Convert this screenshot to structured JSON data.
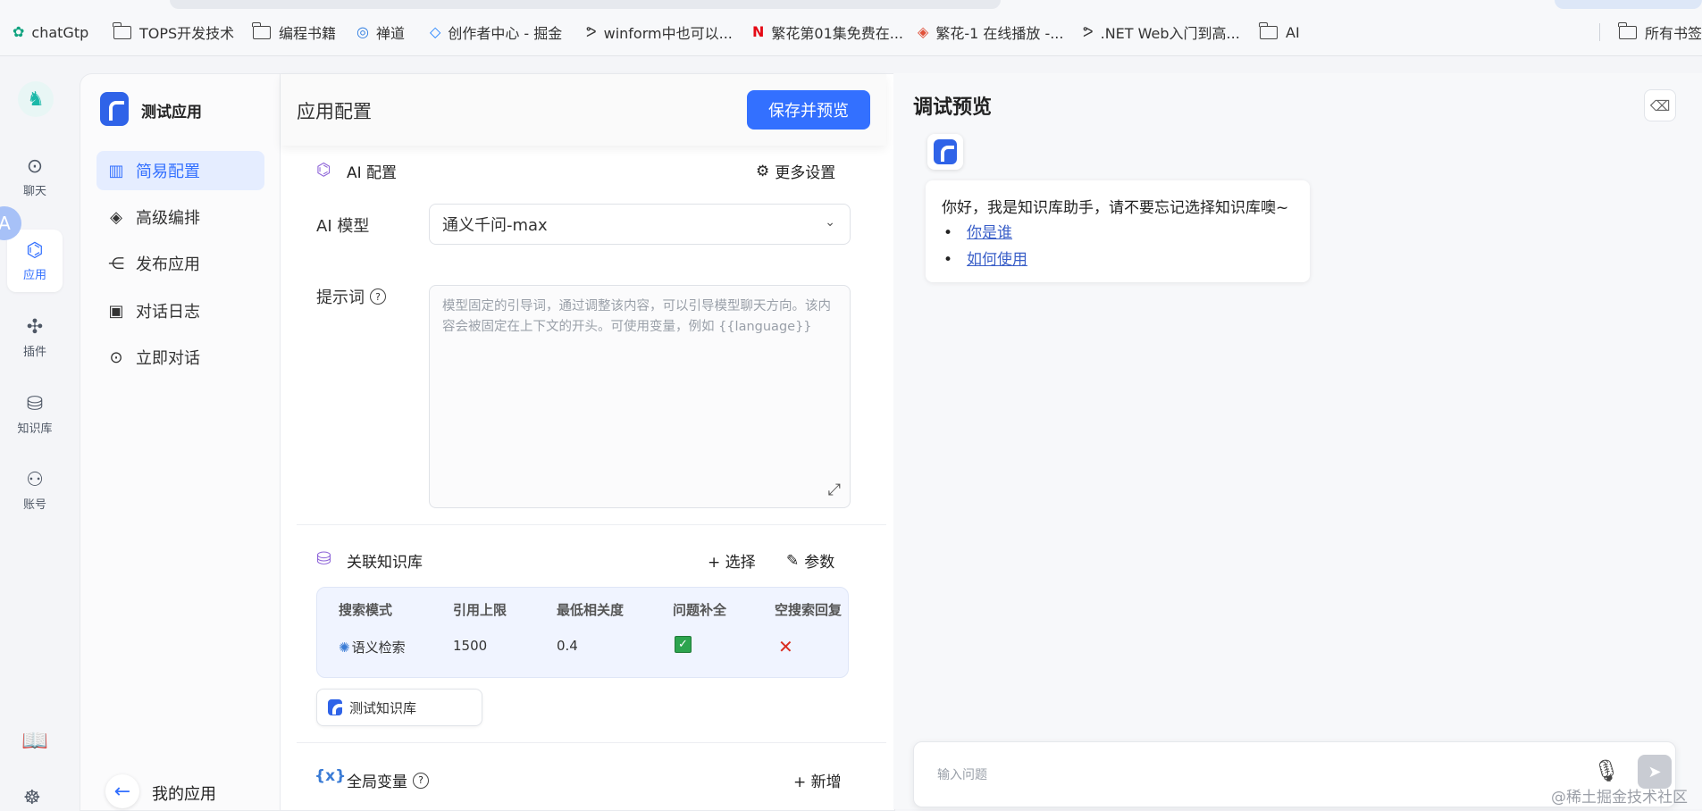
{
  "bookmarks": [
    {
      "label": "chatGtp",
      "icon": "chatgpt-icon"
    },
    {
      "label": "TOPS开发技术",
      "icon": "folder-icon"
    },
    {
      "label": "编程书籍",
      "icon": "folder-icon"
    },
    {
      "label": "禅道",
      "icon": "zentao-icon"
    },
    {
      "label": "创作者中心 - 掘金",
      "icon": "juejin-icon"
    },
    {
      "label": "winform中也可以...",
      "icon": "csdn-icon"
    },
    {
      "label": "繁花第01集免费在...",
      "icon": "netflix-icon"
    },
    {
      "label": "繁花-1 在线播放 -...",
      "icon": "video-icon"
    },
    {
      "label": ".NET Web入门到高...",
      "icon": "csdn-icon"
    },
    {
      "label": "AI",
      "icon": "folder-icon"
    },
    {
      "label": "所有书签",
      "icon": "folder-icon"
    }
  ],
  "rail": {
    "items": [
      {
        "label": "聊天",
        "icon": "chat-icon"
      },
      {
        "label": "应用",
        "icon": "robot-icon"
      },
      {
        "label": "插件",
        "icon": "puzzle-icon"
      },
      {
        "label": "知识库",
        "icon": "database-icon"
      },
      {
        "label": "账号",
        "icon": "user-icon"
      }
    ],
    "floating_badge": "A"
  },
  "app": {
    "name": "测试应用",
    "nav": [
      {
        "label": "简易配置",
        "icon": "bar-chart-icon"
      },
      {
        "label": "高级编排",
        "icon": "layers-icon"
      },
      {
        "label": "发布应用",
        "icon": "share-icon"
      },
      {
        "label": "对话日志",
        "icon": "calendar-icon"
      },
      {
        "label": "立即对话",
        "icon": "chat-dots-icon"
      }
    ],
    "back_label": "我的应用"
  },
  "config": {
    "title": "应用配置",
    "save_button": "保存并预览",
    "ai_section": {
      "title": "AI 配置",
      "more_settings": "更多设置",
      "model_label": "AI 模型",
      "model_value": "通义千问-max",
      "prompt_label": "提示词",
      "prompt_placeholder": "模型固定的引导词，通过调整该内容，可以引导模型聊天方向。该内容会被固定在上下文的开头。可使用变量，例如 {{language}}"
    },
    "kb_section": {
      "title": "关联知识库",
      "select_btn": "+ 选择",
      "params_btn": "参数",
      "columns": [
        "搜索模式",
        "引用上限",
        "最低相关度",
        "问题补全",
        "空搜索回复"
      ],
      "row": {
        "mode": "语义检索",
        "limit": "1500",
        "min_relevance": "0.4",
        "question_completion": true,
        "empty_search_reply": false
      },
      "linked_kb": "测试知识库"
    },
    "vars_section": {
      "title": "全局变量",
      "add_btn": "+ 新增"
    }
  },
  "preview": {
    "title": "调试预览",
    "greeting": "你好，我是知识库助手，请不要忘记选择知识库噢~",
    "suggestions": [
      "你是谁",
      "如何使用"
    ],
    "input_placeholder": "输入问题",
    "watermark": "@稀土掘金技术社区"
  },
  "colors": {
    "primary": "#3370ff",
    "active_bg": "#e5edff",
    "check_green": "#2da44e",
    "cross_red": "#d92d20"
  }
}
